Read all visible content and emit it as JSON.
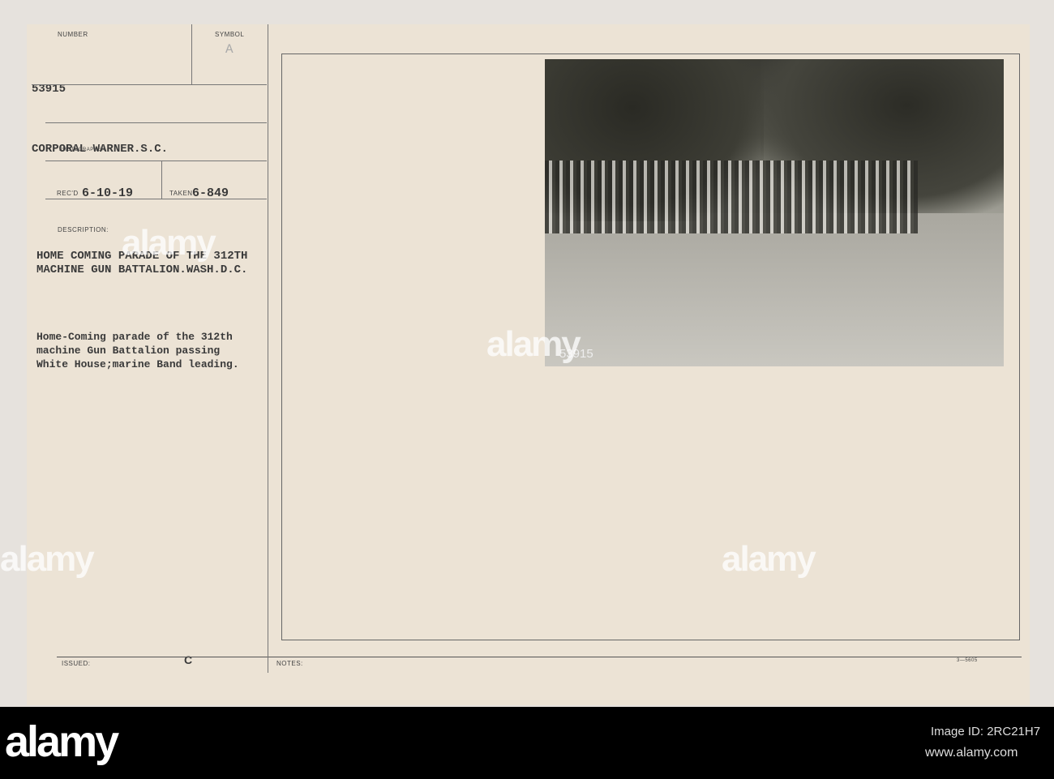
{
  "card": {
    "number_label": "NUMBER",
    "number": "53915",
    "symbol_label": "SYMBOL",
    "symbol": "A",
    "photographer": "CORPORAL WARNER.S.C.",
    "photographer_label": "PHOTOGRAPHER",
    "recd_label": "REC'D",
    "recd": "6-10-19",
    "taken_label": "TAKEN",
    "taken": "6-849",
    "description_label": "DESCRIPTION:",
    "title_line1": "HOME COMING PARADE OF THE 312TH",
    "title_line2": "MACHINE GUN BATTALION.WASH.D.C.",
    "desc_line1": "Home-Coming parade of the 312th",
    "desc_line2": "machine Gun Battalion passing",
    "desc_line3": "White House;marine Band leading.",
    "c_mark": "C",
    "issued_label": "ISSUED:",
    "notes_label": "NOTES:",
    "form_no": "3—5605",
    "photo_number": "53915"
  },
  "watermark": {
    "logo": "alamy",
    "image_id": "Image ID: 2RC21H7",
    "url": "www.alamy.com"
  }
}
